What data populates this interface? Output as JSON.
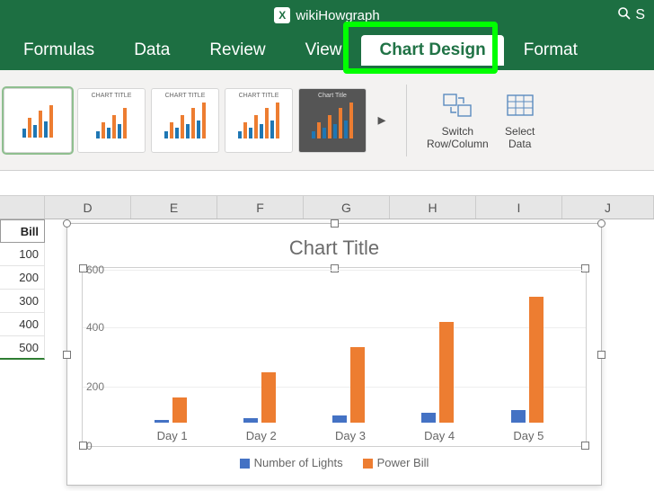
{
  "titlebar": {
    "doc_name": "wikiHowgraph",
    "search_placeholder": "S"
  },
  "tabs": {
    "formulas": "Formulas",
    "data": "Data",
    "review": "Review",
    "view": "View",
    "chart_design": "Chart Design",
    "format": "Format"
  },
  "ribbon": {
    "style_label": "CHART TITLE",
    "style4_label": "Chart Title",
    "switch": "Switch\nRow/Column",
    "select": "Select\nData"
  },
  "columns": {
    "d": "D",
    "e": "E",
    "f": "F",
    "g": "G",
    "h": "H",
    "i": "I",
    "j": "J"
  },
  "cells": {
    "b_header": "Bill",
    "b1": "100",
    "b2": "200",
    "b3": "300",
    "b4": "400",
    "b5": "500"
  },
  "chart": {
    "title": "Chart Title",
    "legend1": "Number of Lights",
    "legend2": "Power Bill",
    "x": {
      "d1": "Day 1",
      "d2": "Day 2",
      "d3": "Day 3",
      "d4": "Day 4",
      "d5": "Day 5"
    },
    "y": {
      "t0": "0",
      "t200": "200",
      "t400": "400",
      "t600": "600"
    }
  },
  "chart_data": {
    "type": "bar",
    "title": "Chart Title",
    "categories": [
      "Day 1",
      "Day 2",
      "Day 3",
      "Day 4",
      "Day 5"
    ],
    "series": [
      {
        "name": "Number of Lights",
        "values": [
          10,
          20,
          30,
          40,
          50
        ],
        "color": "#4472c4"
      },
      {
        "name": "Power Bill",
        "values": [
          100,
          200,
          300,
          400,
          500
        ],
        "color": "#ed7d31"
      }
    ],
    "xlabel": "",
    "ylabel": "",
    "ylim": [
      0,
      600
    ],
    "yticks": [
      0,
      200,
      400,
      600
    ],
    "legend_position": "bottom"
  }
}
